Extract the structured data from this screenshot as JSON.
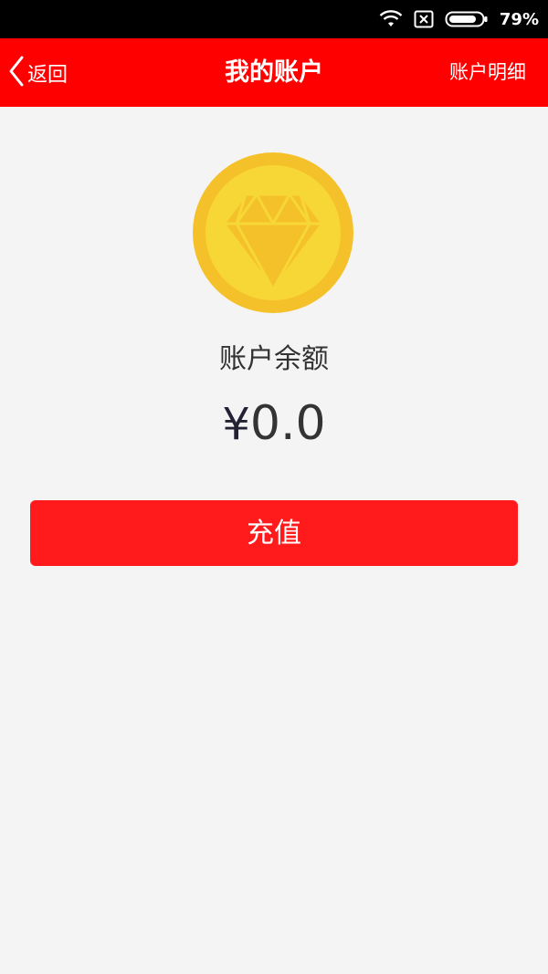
{
  "status_bar": {
    "battery_percent": "79%",
    "icons": [
      "wifi-icon",
      "no-sim-icon",
      "battery-icon"
    ]
  },
  "nav": {
    "back_label": "返回",
    "title": "我的账户",
    "right_label": "账户明细"
  },
  "account": {
    "icon": "diamond-coin-icon",
    "balance_label": "账户余额",
    "currency_symbol": "¥",
    "balance_value": "0.0"
  },
  "actions": {
    "recharge_label": "充值"
  },
  "colors": {
    "nav_background": "#ff0000",
    "button_background": "#ff1b1b",
    "coin_outer": "#f5c12a",
    "coin_inner": "#f7d736",
    "page_background": "#f4f4f4"
  }
}
